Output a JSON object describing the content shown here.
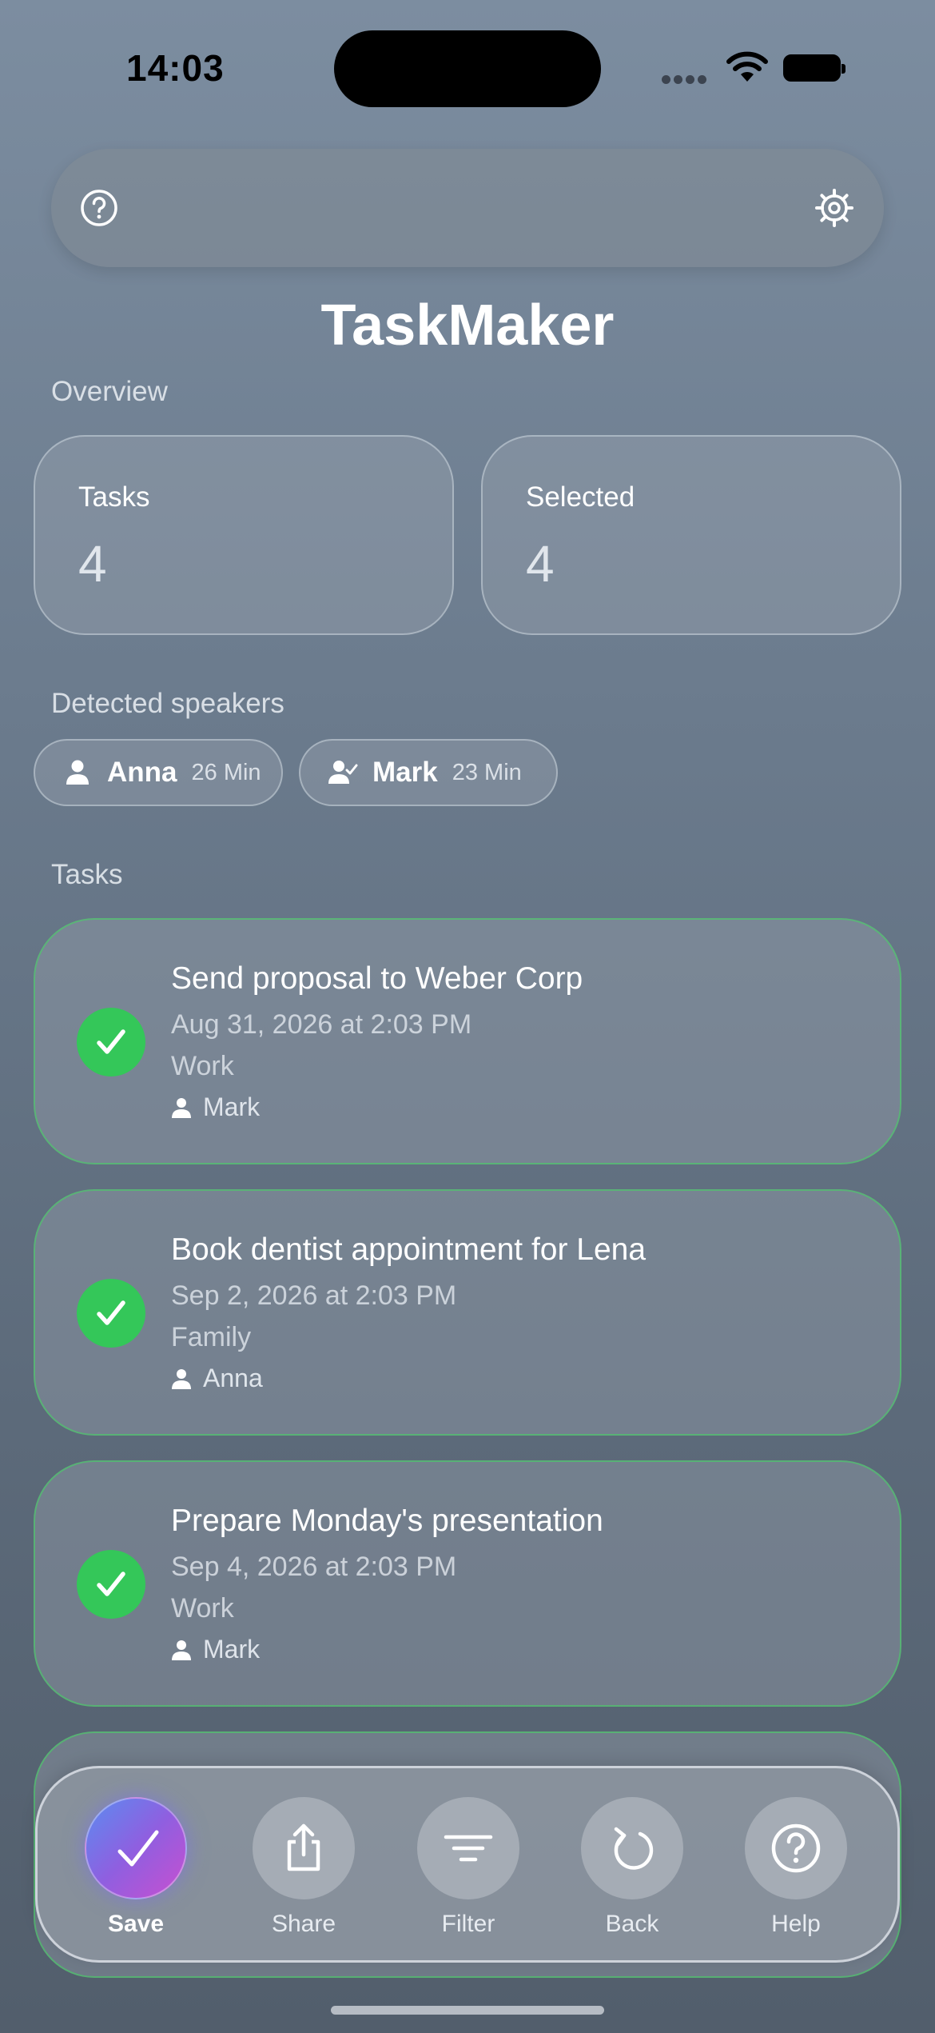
{
  "status_bar": {
    "time": "14:03"
  },
  "app": {
    "title": "TaskMaker"
  },
  "overview": {
    "label": "Overview",
    "cards": [
      {
        "label": "Tasks",
        "value": "4"
      },
      {
        "label": "Selected",
        "value": "4"
      }
    ]
  },
  "speakers": {
    "label": "Detected speakers",
    "items": [
      {
        "name": "Anna",
        "duration": "26 Min",
        "icon": "person-icon"
      },
      {
        "name": "Mark",
        "duration": "23 Min",
        "icon": "person-check-icon"
      }
    ]
  },
  "tasks": {
    "label": "Tasks",
    "items": [
      {
        "title": "Send proposal to Weber Corp",
        "date": "Aug 31, 2026 at 2:03 PM",
        "category": "Work",
        "person": "Mark",
        "selected": true
      },
      {
        "title": "Book dentist appointment for Lena",
        "date": "Sep 2, 2026 at 2:03 PM",
        "category": "Family",
        "person": "Anna",
        "selected": true
      },
      {
        "title": "Prepare Monday's presentation",
        "date": "Sep 4, 2026 at 2:03 PM",
        "category": "Work",
        "person": "Mark",
        "selected": true
      }
    ]
  },
  "actions": [
    {
      "label": "Save",
      "icon": "checkmark-icon"
    },
    {
      "label": "Share",
      "icon": "share-icon"
    },
    {
      "label": "Filter",
      "icon": "filter-icon"
    },
    {
      "label": "Back",
      "icon": "undo-icon"
    },
    {
      "label": "Help",
      "icon": "help-icon"
    }
  ],
  "colors": {
    "accent_green": "#34c759",
    "save_gradient_start": "#5b8cf0",
    "save_gradient_end": "#c84fd0"
  }
}
